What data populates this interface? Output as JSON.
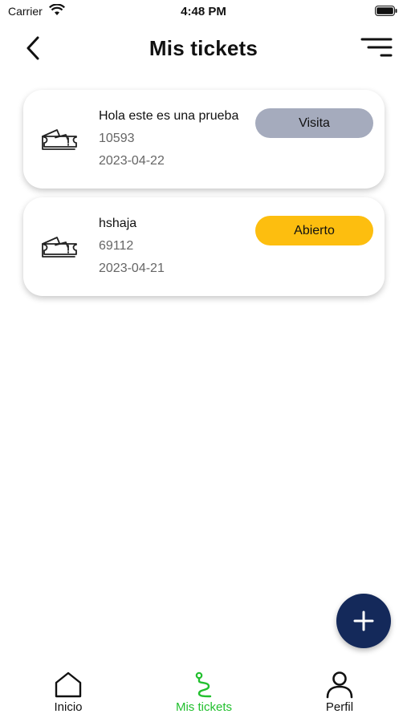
{
  "status_bar": {
    "carrier": "Carrier",
    "time": "4:48 PM"
  },
  "header": {
    "title": "Mis tickets"
  },
  "tickets": [
    {
      "title": "Hola este es una prueba",
      "id": "10593",
      "date": "2023-04-22",
      "status": "Visita",
      "status_color": "#a5abbd"
    },
    {
      "title": "hshaja",
      "id": "69112",
      "date": "2023-04-21",
      "status": "Abierto",
      "status_color": "#fdbe0f"
    }
  ],
  "fab": {
    "icon": "plus-icon"
  },
  "bottom_nav": {
    "items": [
      {
        "label": "Inicio",
        "icon": "home-icon",
        "active": false
      },
      {
        "label": "Mis tickets",
        "icon": "route-icon",
        "active": true
      },
      {
        "label": "Perfil",
        "icon": "user-icon",
        "active": false
      }
    ],
    "active_color": "#22c02e"
  },
  "colors": {
    "primary_dark": "#14295a",
    "text": "#111111",
    "secondary_text": "#666666"
  }
}
